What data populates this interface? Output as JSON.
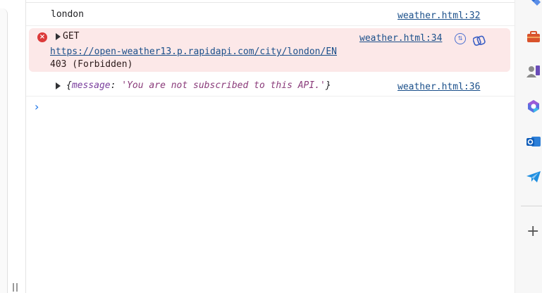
{
  "console": {
    "log1": {
      "text": "london",
      "source": "weather.html:32"
    },
    "error": {
      "method": "GET",
      "url": "https://open-weather13.p.rapidapi.com/city/london/EN",
      "status": "403 (Forbidden)",
      "source": "weather.html:34"
    },
    "log2": {
      "open_brace": "{",
      "key": "message",
      "separator": ": ",
      "value": "'You are not subscribed to this API.'",
      "close_brace": "}",
      "source": "weather.html:36"
    },
    "prompt": "›"
  },
  "colors": {
    "error_bg": "#fce8e8",
    "error_icon": "#dc3a3a",
    "link": "#1a4f8a",
    "prompt": "#1a73e8"
  },
  "sidebar": {
    "icons": [
      "favorites-icon",
      "tools-icon",
      "games-icon",
      "copilot-icon",
      "outlook-icon",
      "telegram-icon",
      "add-icon"
    ],
    "add_label": "+"
  }
}
